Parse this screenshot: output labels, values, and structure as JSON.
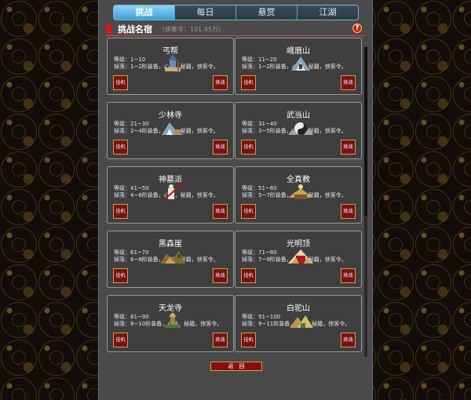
{
  "tabs": [
    "挑战",
    "每日",
    "悬赏",
    "江湖"
  ],
  "active_tab": 0,
  "header": {
    "title": "挑战名宿",
    "subtitle": "（侠客令：101.45万）",
    "help": "?"
  },
  "cards": [
    {
      "name": "丐帮",
      "level": "等级：1~10",
      "drop": "掉落：1~2阶装备，心法，秘籍，侠客令。",
      "art": "beggar",
      "idle": "挂机",
      "fight": "挑战"
    },
    {
      "name": "峨眉山",
      "level": "等级：11~20",
      "drop": "掉落：1~2阶装备，心法，秘籍，侠客令。",
      "art": "emei",
      "idle": "挂机",
      "fight": "挑战"
    },
    {
      "name": "少林寺",
      "level": "等级：21~30",
      "drop": "掉落：2~4阶装备，心法，秘籍，侠客令。",
      "art": "shaolin",
      "idle": "挂机",
      "fight": "挑战"
    },
    {
      "name": "武当山",
      "level": "等级：31~40",
      "drop": "掉落：3~5阶装备，心法，秘籍，侠客令。",
      "art": "wudang",
      "idle": "挂机",
      "fight": "挑战"
    },
    {
      "name": "神墓派",
      "level": "等级：41~50",
      "drop": "掉落：4~6阶装备，心法，秘籍，侠客令。",
      "art": "tomb",
      "idle": "挂机",
      "fight": "挑战"
    },
    {
      "name": "全真教",
      "level": "等级：51~60",
      "drop": "掉落：5~7阶装备，心法，秘籍，侠客令。",
      "art": "quanzhen",
      "idle": "挂机",
      "fight": "挑战"
    },
    {
      "name": "黑森崖",
      "level": "等级：61~70",
      "drop": "掉落：6~8阶装备，心法，秘籍，侠客令。",
      "art": "cliff",
      "idle": "挂机",
      "fight": "挑战"
    },
    {
      "name": "光明顶",
      "level": "等级：71~80",
      "drop": "掉落：7~9阶装备，心法，秘籍，侠客令。",
      "art": "bright",
      "idle": "挂机",
      "fight": "挑战"
    },
    {
      "name": "天龙寺",
      "level": "等级：81~90",
      "drop": "掉落：8~10阶装备，心法，秘籍，侠客令。",
      "art": "tianlong",
      "idle": "挂机",
      "fight": "挑战"
    },
    {
      "name": "白驼山",
      "level": "等级：91~100",
      "drop": "掉落：9~11阶装备，心法，秘籍，侠客令。",
      "art": "baituo",
      "idle": "挂机",
      "fight": "挑战"
    }
  ],
  "back_label": "返　回",
  "colors": {
    "accent_red": "#d81818",
    "tab_active": "#3f9fd6",
    "button_red": "#7a1212",
    "gold_border": "#c9a044"
  }
}
